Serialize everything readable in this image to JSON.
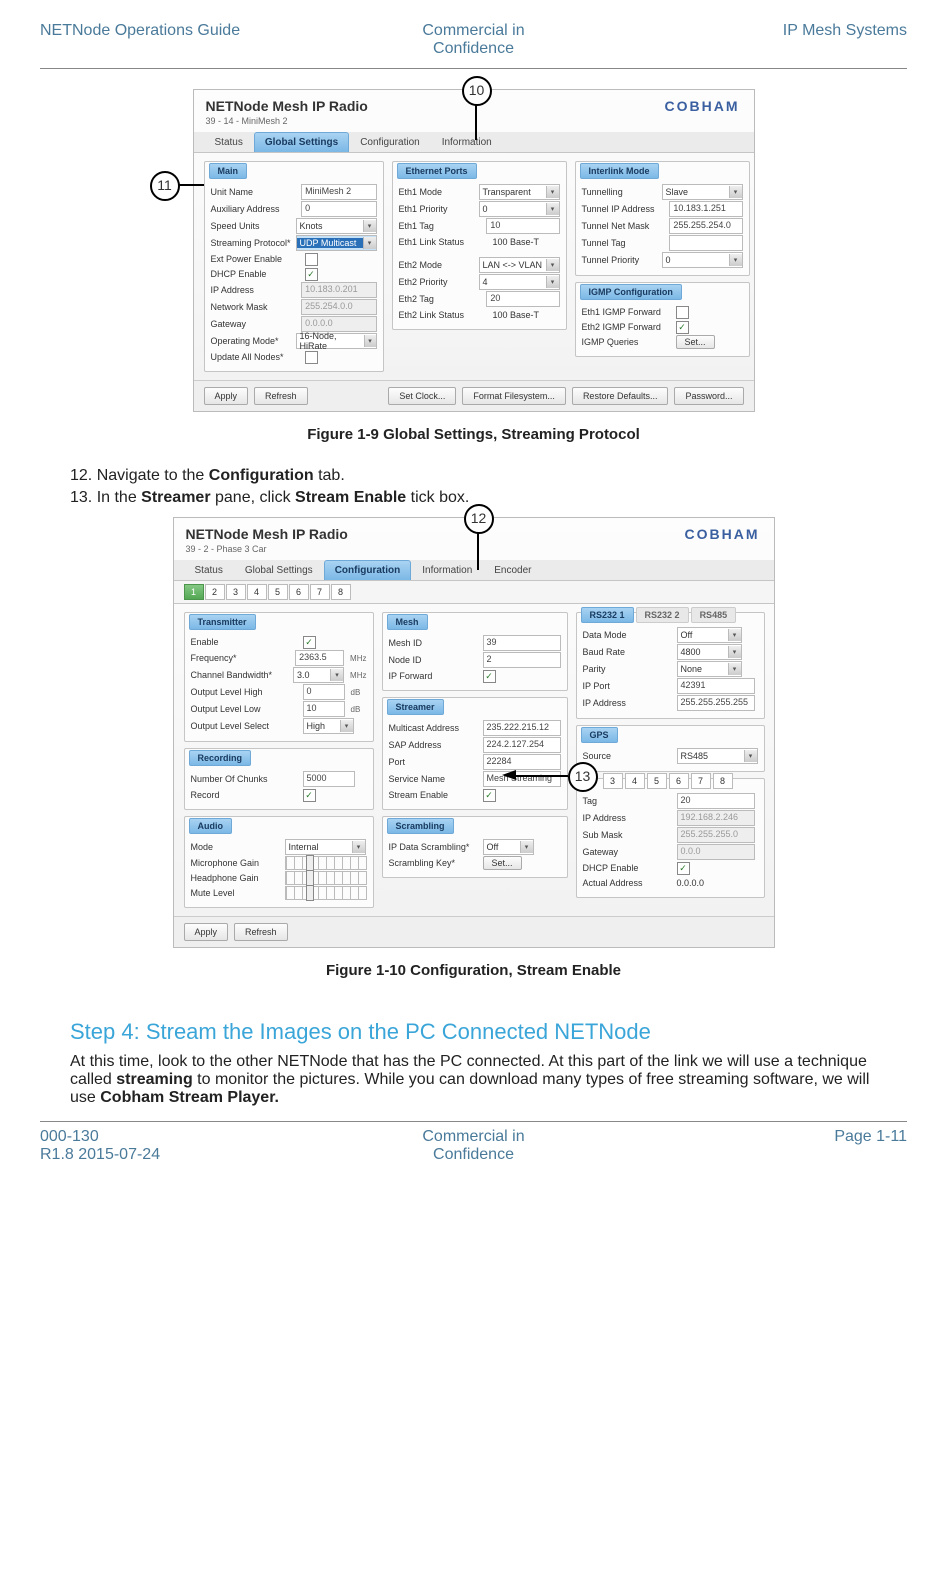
{
  "header": {
    "left": "NETNode Operations Guide",
    "center_l1": "Commercial in",
    "center_l2": "Confidence",
    "right": "IP Mesh Systems"
  },
  "footer": {
    "left_l1": "000-130",
    "left_l2": "R1.8 2015-07-24",
    "center_l1": "Commercial in",
    "center_l2": "Confidence",
    "right": "Page 1-11"
  },
  "fig1_caption": "Figure 1-9 Global Settings, Streaming Protocol",
  "fig2_caption": "Figure 1-10 Configuration, Stream Enable",
  "step12": "12. Navigate to the ",
  "step12b": "Configuration",
  "step12c": " tab.",
  "step13": "13. In the ",
  "step13b": "Streamer",
  "step13c": " pane, click ",
  "step13d": "Stream Enable",
  "step13e": " tick box.",
  "step4_heading": "Step 4: Stream the Images on the PC Connected NETNode",
  "step4_body_1": "At this time, look to the other NETNode that has the PC connected. At this part of the link we will use a technique called ",
  "step4_body_2": "streaming",
  "step4_body_3": " to monitor the pictures. While you can download many types of free streaming software, we will use ",
  "step4_body_4": "Cobham Stream Player.",
  "s1": {
    "title": "NETNode Mesh IP Radio",
    "brand": "COBHAM",
    "sub": "39 - 14 - MiniMesh 2",
    "tabs": [
      "Status",
      "Global Settings",
      "Configuration",
      "Information"
    ],
    "main_title": "Main",
    "main": {
      "unit_name": "MiniMesh 2",
      "aux_addr": "0",
      "speed": "Knots",
      "stream_proto": "UDP Multicast",
      "ip_addr": "10.183.0.201",
      "net_mask": "255.254.0.0",
      "gateway": "0.0.0.0",
      "op_mode": "16-Node, HiRate"
    },
    "eth_title": "Ethernet Ports",
    "eth": {
      "e1mode": "Transparent",
      "e1pri": "0",
      "e1tag": "10",
      "e1link": "100 Base-T",
      "e2mode": "LAN <-> VLAN",
      "e2pri": "4",
      "e2tag": "20",
      "e2link": "100 Base-T"
    },
    "il_title": "Interlink Mode",
    "il": {
      "tun": "Slave",
      "tip": "10.183.1.251",
      "tmask": "255.255.254.0",
      "ttag": "",
      "tpri": "0"
    },
    "igmp_title": "IGMP Configuration",
    "igmp_btn": "Set...",
    "btns": {
      "apply": "Apply",
      "refresh": "Refresh",
      "clock": "Set Clock...",
      "format": "Format Filesystem...",
      "restore": "Restore Defaults...",
      "pwd": "Password..."
    }
  },
  "s2": {
    "title": "NETNode Mesh IP Radio",
    "brand": "COBHAM",
    "sub": "39 - 2 - Phase 3 Car",
    "tabs": [
      "Status",
      "Global Settings",
      "Configuration",
      "Information",
      "Encoder"
    ],
    "numtabs": [
      "1",
      "2",
      "3",
      "4",
      "5",
      "6",
      "7",
      "8"
    ],
    "tx_title": "Transmitter",
    "tx": {
      "freq": "2363.5",
      "bw": "3.0",
      "olh": "0",
      "oll": "10",
      "ols": "High"
    },
    "rec_title": "Recording",
    "rec": {
      "chunks": "5000"
    },
    "aud_title": "Audio",
    "aud": {
      "mode": "Internal"
    },
    "mesh_title": "Mesh",
    "mesh": {
      "mid": "39",
      "nid": "2"
    },
    "str_title": "Streamer",
    "str": {
      "maddr": "235.222.215.12",
      "saddr": "224.2.127.254",
      "port": "22284",
      "svc": "Mesh Streaming"
    },
    "scr_title": "Scrambling",
    "scr": {
      "ipds": "Off",
      "btn": "Set..."
    },
    "rs_title1": "RS232 1",
    "rs_title2": "RS232 2",
    "rs_title3": "RS485",
    "rs": {
      "dm": "Off",
      "baud": "4800",
      "par": "None",
      "ipp": "42391",
      "ipa": "255.255.255.255"
    },
    "gps_title": "GPS",
    "gps": {
      "src": "RS485"
    },
    "net_numtabs": [
      "3",
      "4",
      "5",
      "6",
      "7",
      "8"
    ],
    "net": {
      "tag": "20",
      "ip": "192.168.2.246",
      "mask": "255.255.255.0",
      "gw": "0.0.0",
      "actual": "0.0.0.0"
    },
    "btns": {
      "apply": "Apply",
      "refresh": "Refresh"
    }
  }
}
